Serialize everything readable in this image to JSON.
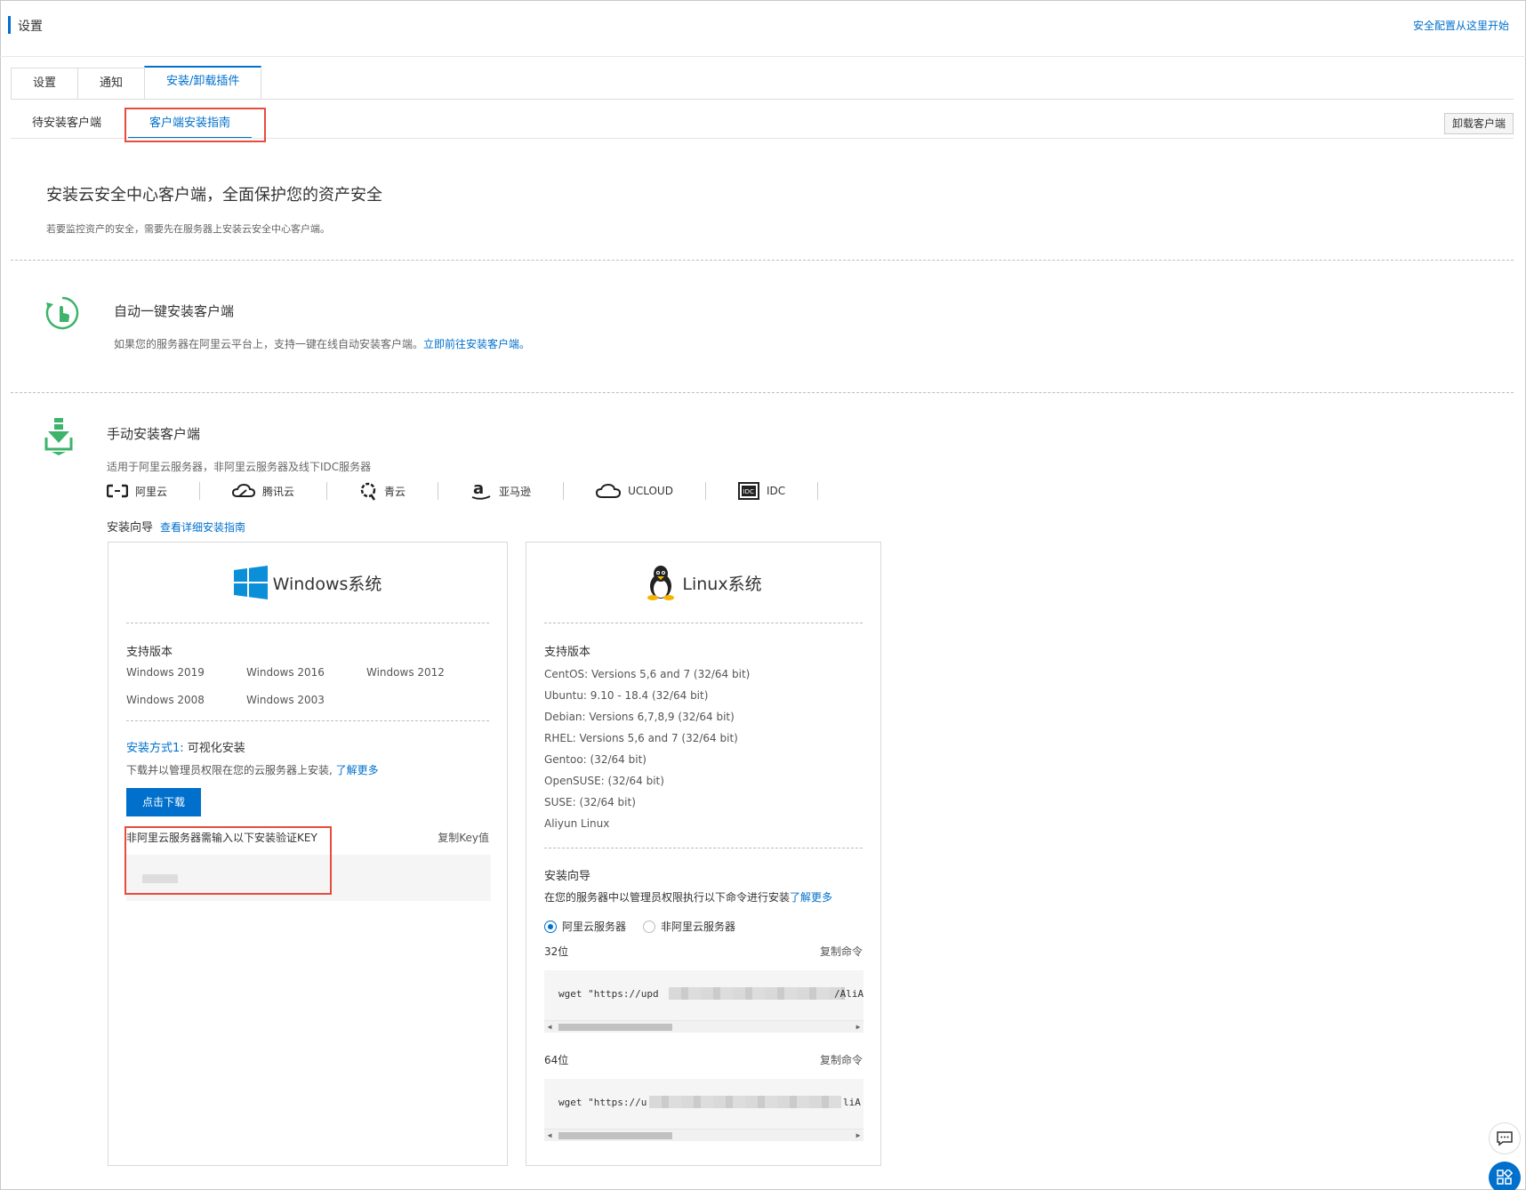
{
  "header": {
    "title": "设置",
    "top_link": "安全配置从这里开始"
  },
  "tabs": [
    "设置",
    "通知",
    "安装/卸载插件"
  ],
  "subtabs": [
    "待安装客户端",
    "客户端安装指南"
  ],
  "uninstall_button": "卸载客户端",
  "hero": {
    "title": "安装云安全中心客户端，全面保护您的资产安全",
    "subtitle": "若要监控资产的安全，需要先在服务器上安装云安全中心客户端。"
  },
  "auto": {
    "title": "自动一键安装客户端",
    "desc": "如果您的服务器在阿里云平台上，支持一键在线自动安装客户端。",
    "link": "立即前往安装客户端。"
  },
  "manual": {
    "title": "手动安装客户端",
    "desc": "适用于阿里云服务器，非阿里云服务器及线下IDC服务器",
    "providers": [
      "阿里云",
      "腾讯云",
      "青云",
      "亚马逊",
      "UCLOUD",
      "IDC"
    ],
    "guide_label": "安装向导",
    "guide_link": "查看详细安装指南"
  },
  "windows": {
    "title": "Windows系统",
    "versions_label": "支持版本",
    "versions": [
      "Windows 2019",
      "Windows 2016",
      "Windows 2012",
      "Windows 2008",
      "Windows 2003"
    ],
    "method_label": "安装方式1:",
    "method_value": "可视化安装",
    "download_desc": "下载并以管理员权限在您的云服务器上安装,",
    "learn_more": "了解更多",
    "download_button": "点击下载",
    "key_label": "非阿里云服务器需输入以下安装验证KEY",
    "copy_key": "复制Key值"
  },
  "linux": {
    "title": "Linux系统",
    "versions_label": "支持版本",
    "versions": [
      "CentOS: Versions 5,6 and 7 (32/64 bit)",
      "Ubuntu: 9.10 - 18.4 (32/64 bit)",
      "Debian: Versions 6,7,8,9 (32/64 bit)",
      "RHEL: Versions 5,6 and 7 (32/64 bit)",
      "Gentoo: (32/64 bit)",
      "OpenSUSE: (32/64 bit)",
      "SUSE: (32/64 bit)",
      "Aliyun Linux"
    ],
    "guide_label": "安装向导",
    "guide_desc": "在您的服务器中以管理员权限执行以下命令进行安装",
    "learn_more": "了解更多",
    "radio_aliyun": "阿里云服务器",
    "radio_non_aliyun": "非阿里云服务器",
    "bit32_label": "32位",
    "bit64_label": "64位",
    "copy_cmd": "复制命令",
    "cmd32_prefix": "wget \"https://upd",
    "cmd32_suffix": "/AliA",
    "cmd64_prefix": "wget \"https://u",
    "cmd64_suffix": "liA"
  },
  "colors": {
    "accent": "#0070cc",
    "highlight": "#e74c3c",
    "green": "#3db36b"
  }
}
